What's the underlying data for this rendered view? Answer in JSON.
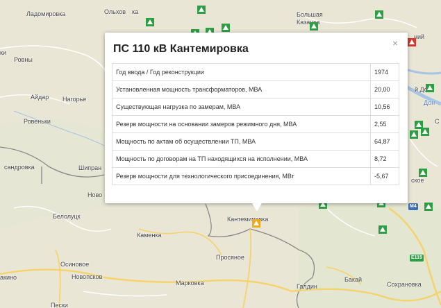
{
  "popup": {
    "title": "ПС 110 кВ Кантемировка",
    "close_label": "×",
    "rows": [
      {
        "label": "Год ввода / Год реконструкции",
        "value": "1974"
      },
      {
        "label": "Установленная мощность трансформаторов, МВА",
        "value": "20,00"
      },
      {
        "label": "Существующая нагрузка по замерам, МВА",
        "value": "10,56"
      },
      {
        "label": "Резерв мощности на основании замеров режимного дня, МВА",
        "value": "2,55"
      },
      {
        "label": "Мощность по актам об осуществлении ТП, МВА",
        "value": "64,87"
      },
      {
        "label": "Мощность по договорам на ТП находящихся на исполнении, МВА",
        "value": "8,72"
      },
      {
        "label": "Резерв мощности для технологического присоединения, МВт",
        "value": "-5,67"
      }
    ]
  },
  "places": {
    "ladomirovka": "Ладомировка",
    "olkhovatka": "Ольхов",
    "bolshaya": "Большая",
    "kazanka": "Казанка",
    "rovny": "Ровны",
    "ki": "ки",
    "aidar": "Айдар",
    "nagorye": "Нагорье",
    "rovenki": "Ровеньки",
    "sandrovka": "сандровка",
    "shipran": "Шипран",
    "novo": "Ново",
    "belolutsk": "Белолуцк",
    "kantemirovka": "Кантемировка",
    "kamenka": "Каменка",
    "prosyanoe": "Просяное",
    "osinovoe": "Осиновое",
    "novopskov": "Новопсков",
    "markovka": "Марковка",
    "galdin": "Галдин",
    "bakai": "Бакай",
    "sokhranovka": "Сохрановка",
    "peski": "Пески",
    "akino": "акино",
    "niy": "ний",
    "don": "й Дон",
    "don2": "Дон",
    "skoe": "ское",
    "ra": "ка",
    "s": "С"
  },
  "shields": {
    "m4": "M4",
    "e115": "E115"
  },
  "colors": {
    "marker_green": "#2e9e44",
    "marker_orange": "#f0a81c",
    "marker_red": "#d23b2d",
    "map_bg": "#eae6d6"
  }
}
